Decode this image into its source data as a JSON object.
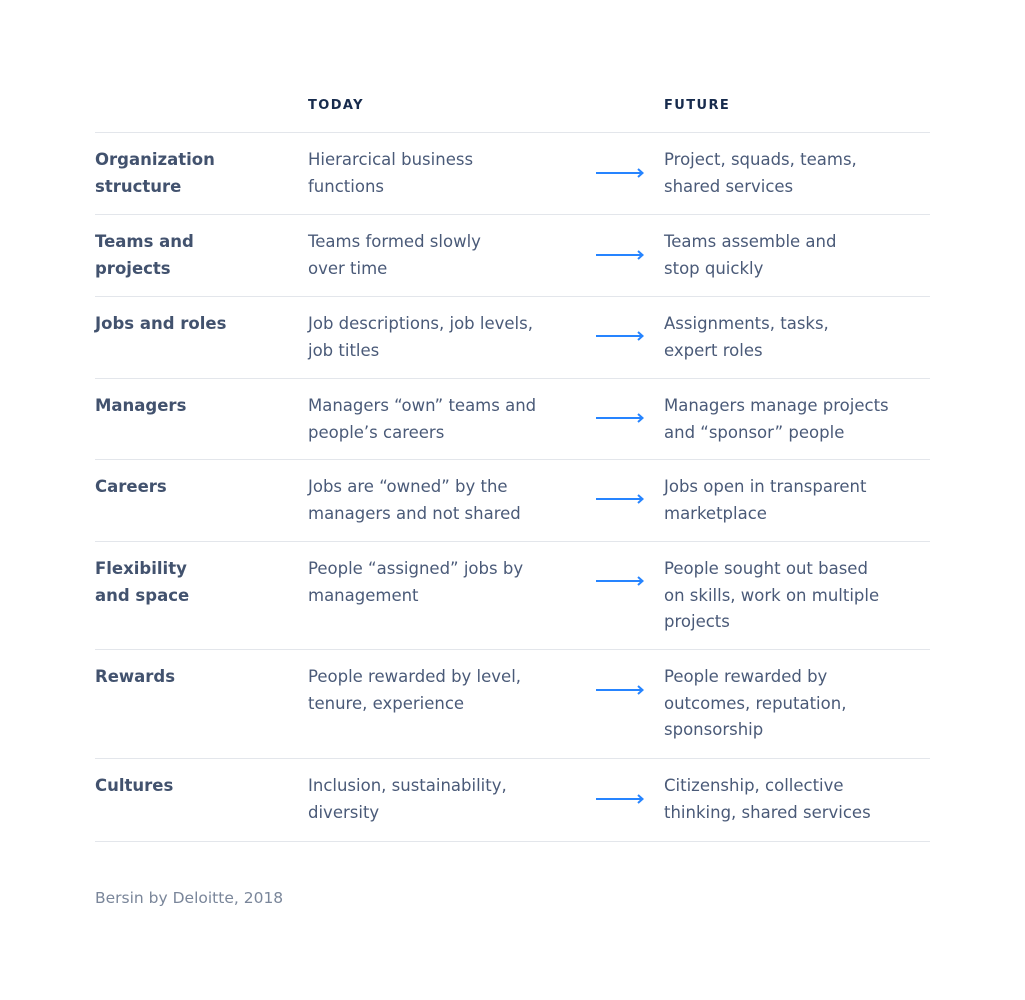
{
  "header": {
    "today_label": "TODAY",
    "future_label": "FUTURE"
  },
  "accent_color": "#2684ff",
  "rows": [
    {
      "label": "Organization\nstructure",
      "today": "Hierarcical business\nfunctions",
      "future": "Project, squads, teams,\nshared services"
    },
    {
      "label": "Teams and\nprojects",
      "today": "Teams formed slowly\nover time",
      "future": "Teams assemble and\nstop quickly"
    },
    {
      "label": "Jobs and roles",
      "today": "Job descriptions, job levels,\njob titles",
      "future": "Assignments, tasks,\nexpert roles"
    },
    {
      "label": "Managers",
      "today": "Managers “own” teams and\npeople’s careers",
      "future": "Managers manage projects\nand “sponsor” people"
    },
    {
      "label": "Careers",
      "today": "Jobs are “owned” by the\nmanagers and not shared",
      "future": "Jobs open in transparent\nmarketplace"
    },
    {
      "label": "Flexibility\nand space",
      "today": "People “assigned” jobs by\nmanagement",
      "future": "People sought out based\non skills, work on multiple\nprojects"
    },
    {
      "label": "Rewards",
      "today": "People rewarded by level,\ntenure, experience",
      "future": "People rewarded by\noutcomes, reputation,\nsponsorship"
    },
    {
      "label": "Cultures",
      "today": "Inclusion, sustainability,\ndiversity",
      "future": "Citizenship, collective\nthinking, shared services"
    }
  ],
  "arrow_icon": "right-arrow-icon",
  "source": "Bersin by Deloitte, 2018"
}
